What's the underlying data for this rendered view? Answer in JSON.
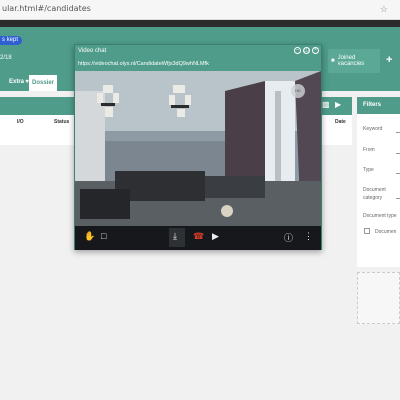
{
  "browser": {
    "url": "ular.html#/candidates",
    "star": "☆"
  },
  "header": {
    "pill": "s kept",
    "date": "2/18",
    "joined_label": "Joined vacancies",
    "plus": "+"
  },
  "tabs": {
    "extra": "Extra ▾",
    "dossier": "Dossier"
  },
  "table": {
    "columns": [
      "I/O",
      "Status",
      "Date"
    ]
  },
  "filters": {
    "title": "Filters",
    "labels": [
      "Keyword",
      "From",
      "Type",
      "Document",
      "category",
      "Document type",
      "Documen"
    ]
  },
  "videochat": {
    "title": "Video chat",
    "url": "https://videochat.olys.nl/CandidateWfjs3dQ9whNLMfk",
    "minimize": "–",
    "restore": "◫",
    "close": "×",
    "hangup_label": "☎",
    "icons": [
      "hand-icon",
      "chat-icon",
      "mic-off-icon",
      "hangup-icon",
      "camera-icon",
      "info-icon",
      "more-icon"
    ]
  },
  "colors": {
    "brand": "#4f9c8a",
    "accent": "#2f5fd0",
    "hangup": "#d93b2b"
  }
}
